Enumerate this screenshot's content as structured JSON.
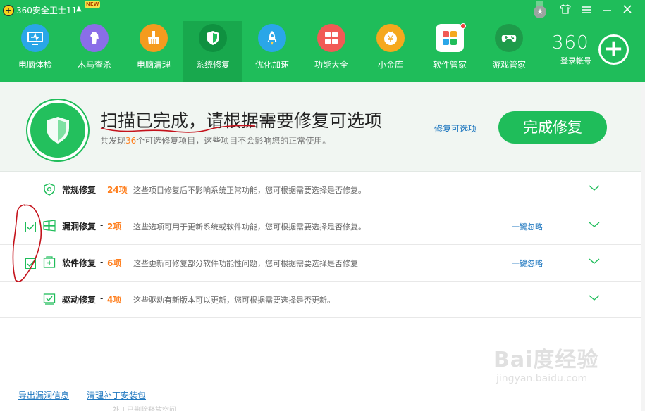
{
  "app": {
    "title": "360安全卫士11",
    "badge": "NEW"
  },
  "window_controls": [
    "shirt-icon",
    "menu-icon",
    "minimize-icon",
    "close-icon"
  ],
  "nav": [
    {
      "label": "电脑体检",
      "icon": "monitor-icon",
      "color": "#2aa6e8"
    },
    {
      "label": "木马查杀",
      "icon": "horse-icon",
      "color": "#8a6ee8"
    },
    {
      "label": "电脑清理",
      "icon": "broom-icon",
      "color": "#f59b1e"
    },
    {
      "label": "系统修复",
      "icon": "shield-icon",
      "color": "#1fbd5a",
      "active": true
    },
    {
      "label": "优化加速",
      "icon": "rocket-icon",
      "color": "#2aa6e8"
    },
    {
      "label": "功能大全",
      "icon": "grid-icon",
      "color": "#f15a55"
    },
    {
      "label": "小金库",
      "icon": "coin-icon",
      "color": "#f5a81e"
    },
    {
      "label": "软件管家",
      "icon": "apps-icon",
      "color": "#ffffff"
    },
    {
      "label": "游戏管家",
      "icon": "gamepad-icon",
      "color": "#1e9b4a"
    }
  ],
  "account": {
    "logo": "360",
    "label": "登录帐号"
  },
  "summary": {
    "title": "扫描已完成，请根据需要修复可选项",
    "sub_prefix": "共发现",
    "sub_count": "36",
    "sub_suffix": "个可选修复项目，这些项目不会影响您的正常使用。",
    "link": "修复可选项",
    "button": "完成修复"
  },
  "rows": [
    {
      "title": "常规修复",
      "dash": "-",
      "count": "24项",
      "desc": "这些项目修复后不影响系统正常功能，您可根据需要选择是否修复。",
      "checkbox": false,
      "ignore": ""
    },
    {
      "title": "漏洞修复",
      "dash": "-",
      "count": "2项",
      "desc": "这些选项可用于更新系统或软件功能，您可根据需要选择是否修复。",
      "checkbox": true,
      "ignore": "一键忽略"
    },
    {
      "title": "软件修复",
      "dash": "-",
      "count": "6项",
      "desc": "这些更新可修复部分软件功能性问题，您可根据需要选择是否修复",
      "checkbox": true,
      "ignore": "一键忽略"
    },
    {
      "title": "驱动修复",
      "dash": "-",
      "count": "4项",
      "desc": "这些驱动有新版本可以更新，您可根据需要选择是否更新。",
      "checkbox": false,
      "ignore": ""
    }
  ],
  "footer": {
    "export": "导出漏洞信息",
    "cleanup": "清理补丁安装包",
    "faded": "补丁已删除释放空间"
  },
  "watermark": {
    "main": "Bai度经验",
    "sub": "jingyan.baidu.com"
  }
}
